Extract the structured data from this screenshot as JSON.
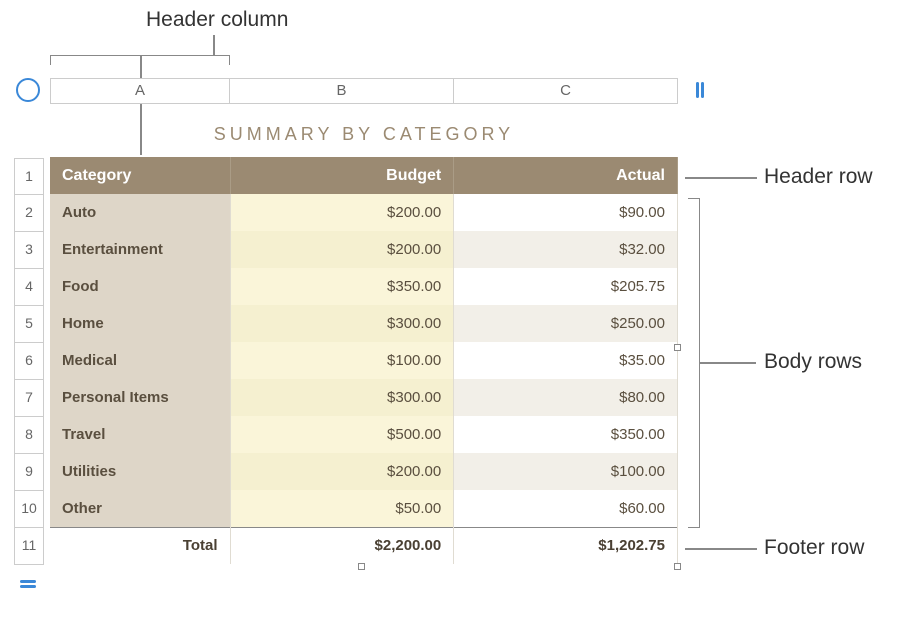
{
  "callouts": {
    "header_column": "Header column",
    "header_row": "Header row",
    "body_rows": "Body rows",
    "footer_row": "Footer row"
  },
  "columns": {
    "a": "A",
    "b": "B",
    "c": "C"
  },
  "row_nums": [
    "1",
    "2",
    "3",
    "4",
    "5",
    "6",
    "7",
    "8",
    "9",
    "10",
    "11"
  ],
  "table": {
    "title": "SUMMARY BY CATEGORY",
    "headers": {
      "category": "Category",
      "budget": "Budget",
      "actual": "Actual"
    },
    "rows": [
      {
        "category": "Auto",
        "budget": "$200.00",
        "actual": "$90.00"
      },
      {
        "category": "Entertainment",
        "budget": "$200.00",
        "actual": "$32.00"
      },
      {
        "category": "Food",
        "budget": "$350.00",
        "actual": "$205.75"
      },
      {
        "category": "Home",
        "budget": "$300.00",
        "actual": "$250.00"
      },
      {
        "category": "Medical",
        "budget": "$100.00",
        "actual": "$35.00"
      },
      {
        "category": "Personal Items",
        "budget": "$300.00",
        "actual": "$80.00"
      },
      {
        "category": "Travel",
        "budget": "$500.00",
        "actual": "$350.00"
      },
      {
        "category": "Utilities",
        "budget": "$200.00",
        "actual": "$100.00"
      },
      {
        "category": "Other",
        "budget": "$50.00",
        "actual": "$60.00"
      }
    ],
    "footer": {
      "label": "Total",
      "budget": "$2,200.00",
      "actual": "$1,202.75"
    }
  }
}
